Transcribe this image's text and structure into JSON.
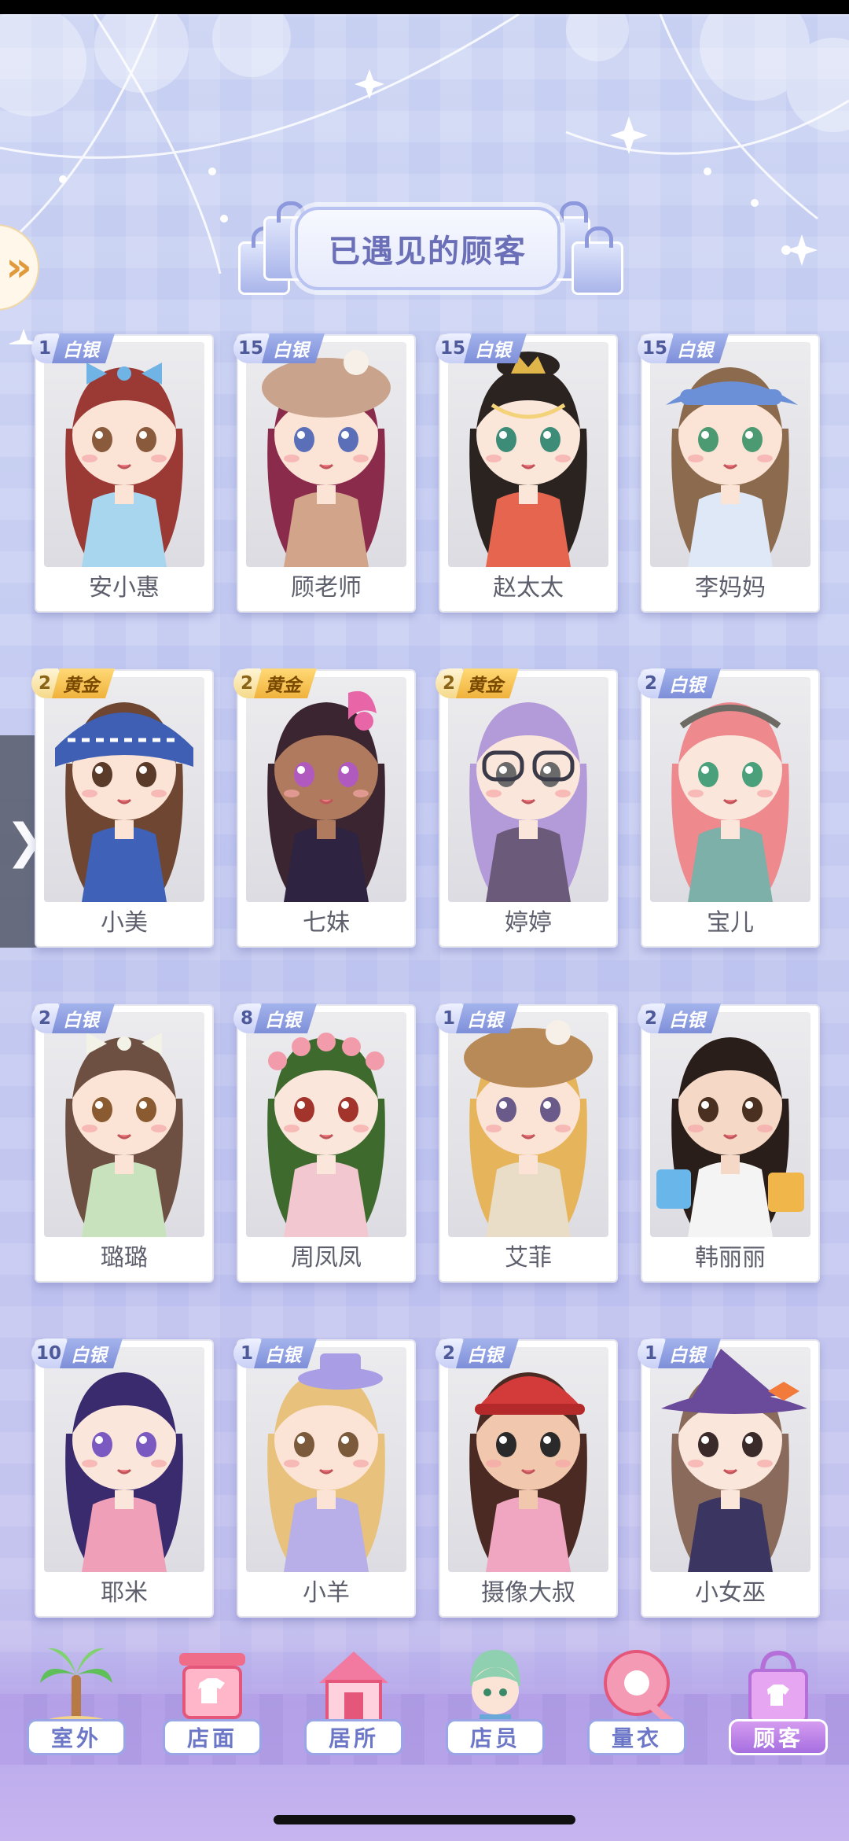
{
  "header": {
    "title": "已遇见的顾客"
  },
  "side": {
    "expand_glyph": "»",
    "drawer_glyph": "❯"
  },
  "customers": [
    {
      "name": "安小惠",
      "count": "1",
      "tier": "白银",
      "tier_type": "silver",
      "hair": "#9b3a35",
      "outfit": "#a9d6ef",
      "skin": "#fbe3d6",
      "accessory": "bow",
      "acc_color": "#6fb4e5",
      "eye": "#8a5a3c"
    },
    {
      "name": "顾老师",
      "count": "15",
      "tier": "白银",
      "tier_type": "silver",
      "hair": "#8b2b4c",
      "outfit": "#d2a48a",
      "skin": "#fbe3d6",
      "accessory": "beret",
      "acc_color": "#c9a38c",
      "eye": "#5b6fb8"
    },
    {
      "name": "赵太太",
      "count": "15",
      "tier": "白银",
      "tier_type": "silver",
      "hair": "#2b2320",
      "outfit": "#e5654e",
      "skin": "#fbe6da",
      "accessory": "crown",
      "acc_color": "#e0b54a",
      "eye": "#3d8c78"
    },
    {
      "name": "李妈妈",
      "count": "15",
      "tier": "白银",
      "tier_type": "silver",
      "hair": "#8c6a4d",
      "outfit": "#dfe8f6",
      "skin": "#fbe3d6",
      "accessory": "visor",
      "acc_color": "#6c90d8",
      "eye": "#4c9a72"
    },
    {
      "name": "小美",
      "count": "2",
      "tier": "黄金",
      "tier_type": "gold",
      "hair": "#6e4632",
      "outfit": "#3f62b8",
      "skin": "#fbe3d6",
      "accessory": "headwrap",
      "acc_color": "#3e5fb3",
      "eye": "#5a3a28"
    },
    {
      "name": "七妹",
      "count": "2",
      "tier": "黄金",
      "tier_type": "gold",
      "hair": "#3b2530",
      "outfit": "#2e2340",
      "skin": "#b07a5e",
      "accessory": "horns",
      "acc_color": "#e865a8",
      "eye": "#b05ac0"
    },
    {
      "name": "婷婷",
      "count": "2",
      "tier": "黄金",
      "tier_type": "gold",
      "hair": "#b39ad8",
      "outfit": "#6c5a7a",
      "skin": "#fbe6dc",
      "accessory": "glasses",
      "acc_color": "#3a3a48",
      "eye": "#6a6a6a"
    },
    {
      "name": "宝儿",
      "count": "2",
      "tier": "白银",
      "tier_type": "silver",
      "hair": "#ee8a8e",
      "outfit": "#7cb0a8",
      "skin": "#fbe6dc",
      "accessory": "headband",
      "acc_color": "#6e6a64",
      "eye": "#4aa07a"
    },
    {
      "name": "璐璐",
      "count": "2",
      "tier": "白银",
      "tier_type": "silver",
      "hair": "#6e5042",
      "outfit": "#c7e2bd",
      "skin": "#fbe3d6",
      "accessory": "bow",
      "acc_color": "#f2f2e6",
      "eye": "#8a5a30"
    },
    {
      "name": "周凤凤",
      "count": "8",
      "tier": "白银",
      "tier_type": "silver",
      "hair": "#3f6a2e",
      "outfit": "#f3c7cf",
      "skin": "#fbe6dc",
      "accessory": "flowers",
      "acc_color": "#f29cab",
      "eye": "#a3342c"
    },
    {
      "name": "艾菲",
      "count": "1",
      "tier": "白银",
      "tier_type": "silver",
      "hair": "#e6b45a",
      "outfit": "#e9ddc8",
      "skin": "#fbe3d6",
      "accessory": "beret",
      "acc_color": "#b88a58",
      "eye": "#6a5a8a"
    },
    {
      "name": "韩丽丽",
      "count": "2",
      "tier": "白银",
      "tier_type": "silver",
      "hair": "#2a1e1a",
      "outfit": "#f4f4f4",
      "skin": "#f6d8c6",
      "accessory": "bags",
      "acc_color": "#68b6ea",
      "eye": "#4a3020"
    },
    {
      "name": "耶米",
      "count": "10",
      "tier": "白银",
      "tier_type": "silver",
      "hair": "#3a2a6e",
      "outfit": "#ef9fb7",
      "skin": "#fbe6dc",
      "accessory": "none",
      "acc_color": "#e55e5e",
      "eye": "#7a5ac0"
    },
    {
      "name": "小羊",
      "count": "1",
      "tier": "白银",
      "tier_type": "silver",
      "hair": "#e8c27c",
      "outfit": "#b8aee8",
      "skin": "#fbe3d6",
      "accessory": "tophat",
      "acc_color": "#a99ee5",
      "eye": "#7a5a3a"
    },
    {
      "name": "摄像大叔",
      "count": "2",
      "tier": "白银",
      "tier_type": "silver",
      "hair": "#4a2a22",
      "outfit": "#f0a6c0",
      "skin": "#f1c7ae",
      "accessory": "cap",
      "acc_color": "#d33a3a",
      "eye": "#2a2a2a"
    },
    {
      "name": "小女巫",
      "count": "1",
      "tier": "白银",
      "tier_type": "silver",
      "hair": "#8a6a5a",
      "outfit": "#3b3562",
      "skin": "#fbe6dc",
      "accessory": "witchhat",
      "acc_color": "#6a4a9a",
      "eye": "#3a2a2a"
    }
  ],
  "nav": [
    {
      "label": "室外",
      "icon": "palm-tree-icon",
      "active": false
    },
    {
      "label": "店面",
      "icon": "shop-sign-icon",
      "active": false
    },
    {
      "label": "居所",
      "icon": "house-icon",
      "active": false
    },
    {
      "label": "店员",
      "icon": "staff-portrait-icon",
      "active": false
    },
    {
      "label": "量衣",
      "icon": "measuring-tape-icon",
      "active": false
    },
    {
      "label": "顾客",
      "icon": "shopping-bag-icon",
      "active": true
    }
  ]
}
